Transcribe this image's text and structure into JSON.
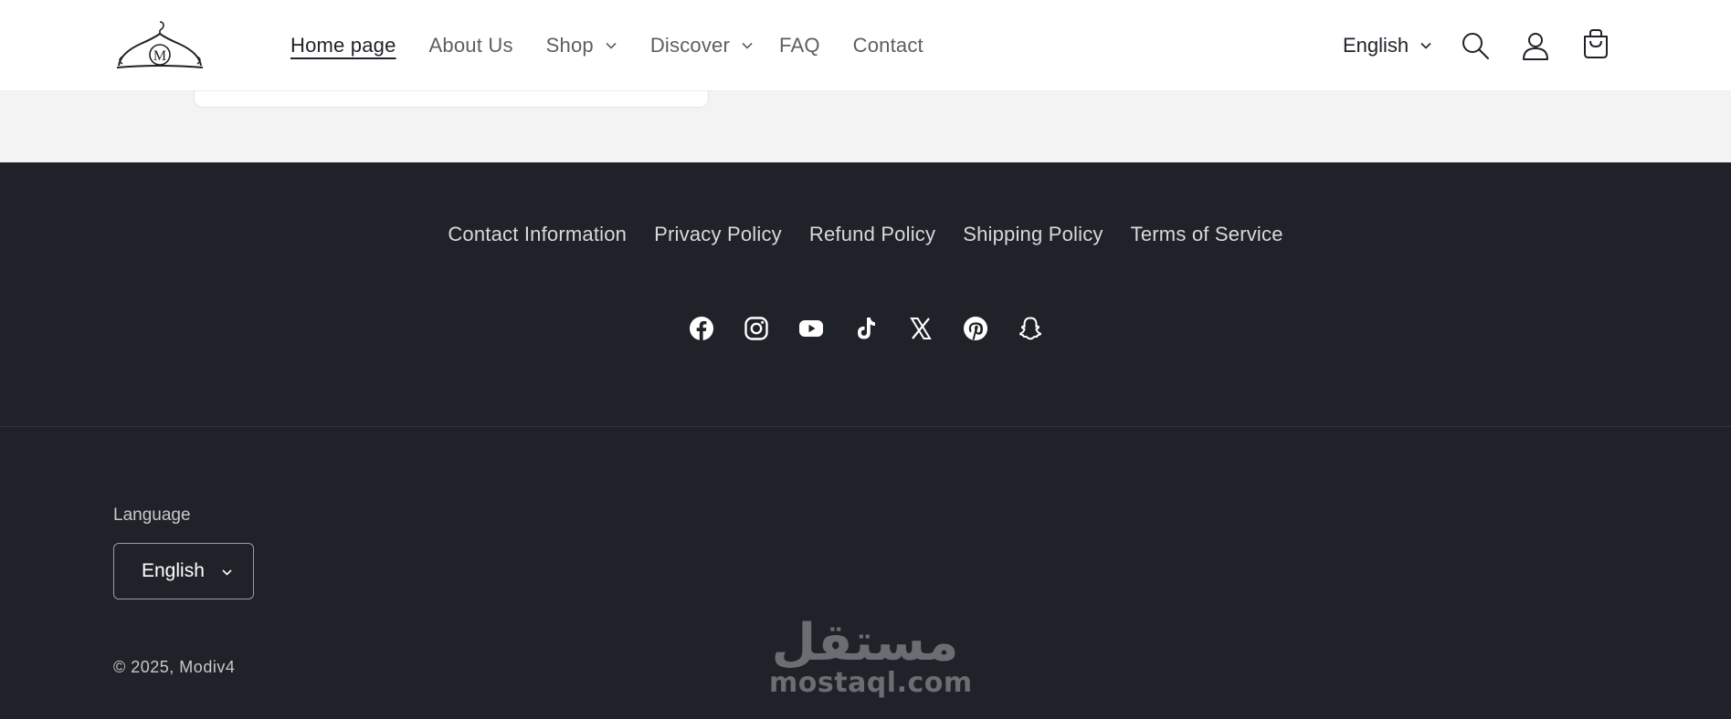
{
  "header": {
    "logo_icon": "hanger-logo-icon",
    "logo_letter": "M",
    "nav": [
      {
        "label": "Home page",
        "active": true,
        "has_dropdown": false
      },
      {
        "label": "About Us",
        "active": false,
        "has_dropdown": false
      },
      {
        "label": "Shop",
        "active": false,
        "has_dropdown": true
      },
      {
        "label": "Discover",
        "active": false,
        "has_dropdown": true
      },
      {
        "label": "FAQ",
        "active": false,
        "has_dropdown": false
      },
      {
        "label": "Contact",
        "active": false,
        "has_dropdown": false
      }
    ],
    "language": "English",
    "icons": [
      "search-icon",
      "account-icon",
      "cart-icon"
    ]
  },
  "footer": {
    "policy_links": [
      "Contact Information",
      "Privacy Policy",
      "Refund Policy",
      "Shipping Policy",
      "Terms of Service"
    ],
    "social_icons": [
      "facebook-icon",
      "instagram-icon",
      "youtube-icon",
      "tiktok-icon",
      "x-icon",
      "pinterest-icon",
      "snapchat-icon"
    ],
    "language_label": "Language",
    "language_value": "English",
    "copyright": "© 2025, Modiv4"
  },
  "watermark": {
    "arabic": "مستقل",
    "latin": "mostaql.com"
  },
  "colors": {
    "footer_bg": "#1f2228",
    "header_bg": "#ffffff",
    "strip_bg": "#f3f3f3",
    "text_dark": "#1f2228",
    "text_muted": "#5b5f63"
  }
}
